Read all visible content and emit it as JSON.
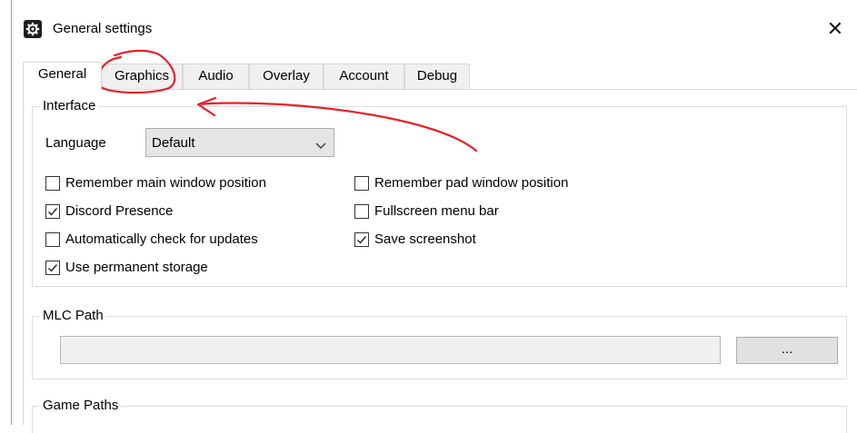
{
  "window": {
    "title": "General settings",
    "close_symbol": "✕"
  },
  "tabs": [
    {
      "label": "General",
      "active": true
    },
    {
      "label": "Graphics",
      "active": false
    },
    {
      "label": "Audio",
      "active": false
    },
    {
      "label": "Overlay",
      "active": false
    },
    {
      "label": "Account",
      "active": false
    },
    {
      "label": "Debug",
      "active": false
    }
  ],
  "interface": {
    "title": "Interface",
    "language_label": "Language",
    "language_value": "Default",
    "checkboxes": [
      {
        "label": "Remember main window position",
        "checked": false
      },
      {
        "label": "Remember pad window position",
        "checked": false
      },
      {
        "label": "Discord Presence",
        "checked": true
      },
      {
        "label": "Fullscreen menu bar",
        "checked": false
      },
      {
        "label": "Automatically check for updates",
        "checked": false
      },
      {
        "label": "Save screenshot",
        "checked": true
      },
      {
        "label": "Use permanent storage",
        "checked": true
      }
    ]
  },
  "mlc_path": {
    "title": "MLC Path",
    "value": "",
    "browse_label": "..."
  },
  "game_paths": {
    "title": "Game Paths"
  },
  "annotation": {
    "color": "#e8202a"
  }
}
